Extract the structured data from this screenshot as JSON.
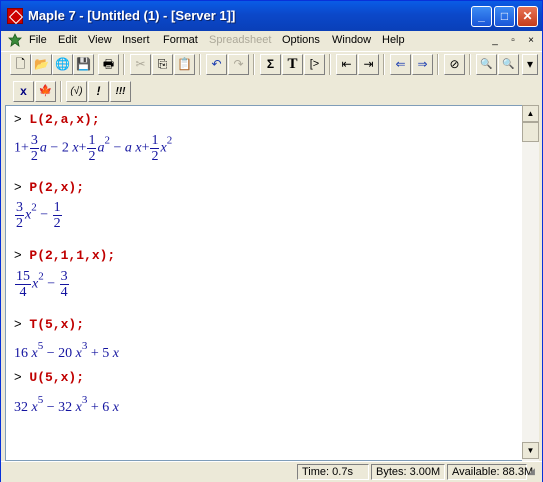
{
  "window": {
    "title": "Maple 7  - [Untitled (1) - [Server 1]]",
    "buttons": {
      "minimize": "_",
      "maximize": "□",
      "close": "✕"
    }
  },
  "menubar": {
    "items": [
      {
        "label": "File",
        "enabled": true
      },
      {
        "label": "Edit",
        "enabled": true
      },
      {
        "label": "View",
        "enabled": true
      },
      {
        "label": "Insert",
        "enabled": true
      },
      {
        "label": "Format",
        "enabled": true
      },
      {
        "label": "Spreadsheet",
        "enabled": false
      },
      {
        "label": "Options",
        "enabled": true
      },
      {
        "label": "Window",
        "enabled": true
      },
      {
        "label": "Help",
        "enabled": true
      }
    ],
    "mdi_buttons": {
      "minimize": "_",
      "restore": "▫",
      "close": "×"
    }
  },
  "toolbar": {
    "new": "🗋",
    "open": "📂",
    "open_url": "🌐",
    "save": "💾",
    "print": "🖶",
    "cut": "✂",
    "copy": "⎘",
    "paste": "📋",
    "undo": "↶",
    "redo": "↷",
    "sigma": "Σ",
    "text": "T",
    "input": "[>",
    "outdent": "⇤",
    "indent": "⇥",
    "back": "⇐",
    "forward": "⇒",
    "stop": "⊘",
    "zoom_in": "🔍",
    "zoom_out": "🔍"
  },
  "toolbar2": {
    "x_label": "x",
    "maple_leaf": "🍁",
    "eval_label": "(√)",
    "bang": "!",
    "bang3": "!!!"
  },
  "worksheet": {
    "prompt_symbol": ">",
    "cmd1": "L(2,a,x);",
    "cmd2": "P(2,x);",
    "cmd3": "P(2,1,1,x);",
    "cmd4": "T(5,x);",
    "cmd5": "U(5,x);",
    "out1": {
      "one": "1",
      "plus": "+",
      "minus": "−",
      "f1_num": "3",
      "f1_den": "2",
      "a": "a",
      "two_x": "2",
      "x": "x",
      "f2_num": "1",
      "f2_den": "2",
      "exp2": "2",
      "ax_a": "a",
      "ax_x": "x",
      "f3_num": "1",
      "f3_den": "2"
    },
    "out2": {
      "f1_num": "3",
      "f1_den": "2",
      "x": "x",
      "exp": "2",
      "minus": "−",
      "f2_num": "1",
      "f2_den": "2"
    },
    "out3": {
      "f1_num": "15",
      "f1_den": "4",
      "x": "x",
      "exp": "2",
      "minus": "−",
      "f2_num": "3",
      "f2_den": "4"
    },
    "out4": {
      "c1": "16",
      "e1": "5",
      "op1": "−",
      "c2": "20",
      "e2": "3",
      "op2": "+",
      "c3": "5",
      "x": "x"
    },
    "out5": {
      "c1": "32",
      "e1": "5",
      "op1": "−",
      "c2": "32",
      "e2": "3",
      "op2": "+",
      "c3": "6",
      "x": "x"
    }
  },
  "statusbar": {
    "time": "Time:   0.7s",
    "bytes": "Bytes: 3.00M",
    "available": "Available: 88.3M"
  }
}
